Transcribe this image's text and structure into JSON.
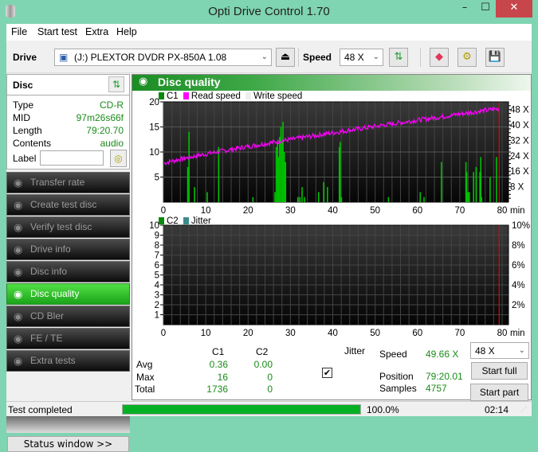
{
  "window": {
    "title": "Opti Drive Control 1.70",
    "minimize": "–",
    "maximize": "☐",
    "close": "✕"
  },
  "menu": [
    "File",
    "Start test",
    "Extra",
    "Help"
  ],
  "toolbar": {
    "drive_label": "Drive",
    "drive_value": "(J:)  PLEXTOR DVDR   PX-850A 1.08",
    "speed_label": "Speed",
    "speed_value": "48 X",
    "eject_icon": "⏏",
    "refresh_icon": "⇅",
    "erase_icon": "◆",
    "settings_icon": "⚙",
    "save_icon": "💾"
  },
  "disc": {
    "title": "Disc",
    "rows": [
      {
        "key": "Type",
        "value": "CD-R"
      },
      {
        "key": "MID",
        "value": "97m26s66f"
      },
      {
        "key": "Length",
        "value": "79:20.70"
      },
      {
        "key": "Contents",
        "value": "audio"
      }
    ],
    "label_key": "Label",
    "label_value": ""
  },
  "nav": [
    {
      "label": "Transfer rate",
      "active": false
    },
    {
      "label": "Create test disc",
      "active": false
    },
    {
      "label": "Verify test disc",
      "active": false
    },
    {
      "label": "Drive info",
      "active": false
    },
    {
      "label": "Disc info",
      "active": false
    },
    {
      "label": "Disc quality",
      "active": true
    },
    {
      "label": "CD Bler",
      "active": false
    },
    {
      "label": "FE / TE",
      "active": false
    },
    {
      "label": "Extra tests",
      "active": false
    }
  ],
  "status_window_button": "Status window >>",
  "panel_title": "Disc quality",
  "chart_data": [
    {
      "type": "bar",
      "title": "C1 / Read speed",
      "legend": [
        "C1",
        "Read speed",
        "Write speed"
      ],
      "xlabel": "min",
      "xlim": [
        0,
        80
      ],
      "xticks": [
        "0",
        "10",
        "20",
        "30",
        "40",
        "50",
        "60",
        "70",
        "80"
      ],
      "ylim": [
        0,
        20
      ],
      "yticks": [
        "5",
        "10",
        "15",
        "20"
      ],
      "y2ticks": [
        "8 X",
        "16 X",
        "24 X",
        "32 X",
        "40 X",
        "48 X"
      ],
      "y2lim": [
        0,
        52
      ],
      "c1_spikes": [
        {
          "x": 5.6,
          "y": 7
        },
        {
          "x": 5.9,
          "y": 14
        },
        {
          "x": 7.2,
          "y": 3
        },
        {
          "x": 10.2,
          "y": 2
        },
        {
          "x": 12.9,
          "y": 11
        },
        {
          "x": 21,
          "y": 1
        },
        {
          "x": 26.2,
          "y": 2
        },
        {
          "x": 26.5,
          "y": 11
        },
        {
          "x": 26.8,
          "y": 12
        },
        {
          "x": 27.0,
          "y": 9
        },
        {
          "x": 27.3,
          "y": 13
        },
        {
          "x": 27.6,
          "y": 15
        },
        {
          "x": 27.9,
          "y": 12
        },
        {
          "x": 28.1,
          "y": 16
        },
        {
          "x": 28.4,
          "y": 10
        },
        {
          "x": 28.7,
          "y": 8
        },
        {
          "x": 31.6,
          "y": 1
        },
        {
          "x": 32.1,
          "y": 1
        },
        {
          "x": 32.6,
          "y": 3
        },
        {
          "x": 33.2,
          "y": 1
        },
        {
          "x": 36.5,
          "y": 2
        },
        {
          "x": 37.7,
          "y": 4
        },
        {
          "x": 38.6,
          "y": 3
        },
        {
          "x": 41.4,
          "y": 11
        },
        {
          "x": 41.6,
          "y": 12
        },
        {
          "x": 41.9,
          "y": 1
        },
        {
          "x": 53,
          "y": 1
        },
        {
          "x": 60.5,
          "y": 2
        },
        {
          "x": 61.4,
          "y": 1
        },
        {
          "x": 65.5,
          "y": 8
        },
        {
          "x": 71.3,
          "y": 8
        },
        {
          "x": 71.5,
          "y": 6
        },
        {
          "x": 71.8,
          "y": 2
        },
        {
          "x": 72.1,
          "y": 2
        },
        {
          "x": 73.1,
          "y": 6
        },
        {
          "x": 73.7,
          "y": 7
        },
        {
          "x": 74.6,
          "y": 6
        },
        {
          "x": 74.8,
          "y": 9
        },
        {
          "x": 75.0,
          "y": 1
        },
        {
          "x": 77.0,
          "y": 5
        },
        {
          "x": 78.5,
          "y": 9
        }
      ],
      "read_speed": {
        "start_x": 20,
        "end_x": 48.5,
        "x_range": [
          0,
          80
        ]
      }
    },
    {
      "type": "bar",
      "title": "C2 / Jitter",
      "legend": [
        "C2",
        "Jitter"
      ],
      "xlabel": "min",
      "xlim": [
        0,
        80
      ],
      "xticks": [
        "0",
        "10",
        "20",
        "30",
        "40",
        "50",
        "60",
        "70",
        "80"
      ],
      "ylim": [
        0,
        10
      ],
      "yticks": [
        "1",
        "2",
        "3",
        "4",
        "5",
        "6",
        "7",
        "8",
        "9",
        "10"
      ],
      "y2ticks": [
        "2%",
        "4%",
        "6%",
        "8%",
        "10%"
      ],
      "c2_values": []
    }
  ],
  "stats": {
    "col_c1": "C1",
    "col_c2": "C2",
    "rows": [
      {
        "label": "Avg",
        "c1": "0.36",
        "c2": "0.00"
      },
      {
        "label": "Max",
        "c1": "16",
        "c2": "0"
      },
      {
        "label": "Total",
        "c1": "1736",
        "c2": "0"
      }
    ],
    "jitter_label": "Jitter",
    "jitter_checked": true,
    "speed_label": "Speed",
    "speed_value": "49.66 X",
    "position_label": "Position",
    "position_value": "79:20.01",
    "samples_label": "Samples",
    "samples_value": "4757",
    "speed_select": "48 X",
    "start_full": "Start full",
    "start_part": "Start part"
  },
  "statusbar": {
    "text": "Test completed",
    "progress_percent": 100,
    "progress_label": "100.0%",
    "time": "02:14"
  },
  "colors": {
    "c1": "#00c000",
    "read_speed": "#ff00ff",
    "accent": "#1b8d23",
    "progress": "#06b025"
  }
}
